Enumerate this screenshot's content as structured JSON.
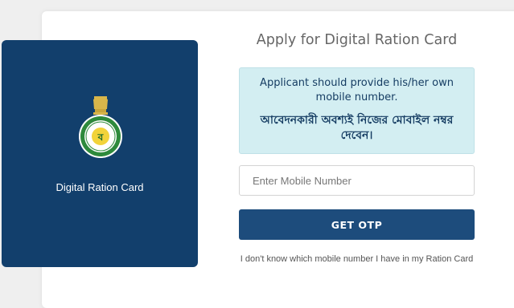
{
  "left_panel": {
    "title": "Digital Ration Card",
    "emblem_icon": "west-bengal-emblem-icon"
  },
  "form": {
    "title": "Apply for Digital Ration Card",
    "notice_en": "Applicant should provide his/her own mobile number.",
    "notice_bn": "আবেদনকারী অবশ্যই নিজের মোবাইল নম্বর দেবেন।",
    "mobile_placeholder": "Enter Mobile Number",
    "mobile_value": "",
    "otp_button": "GET OTP",
    "help_link": "I don't know which mobile number I have in my Ration Card"
  },
  "colors": {
    "panel_bg": "#123f6c",
    "notice_bg": "#d3eef2",
    "button_bg": "#1d4c7c"
  }
}
